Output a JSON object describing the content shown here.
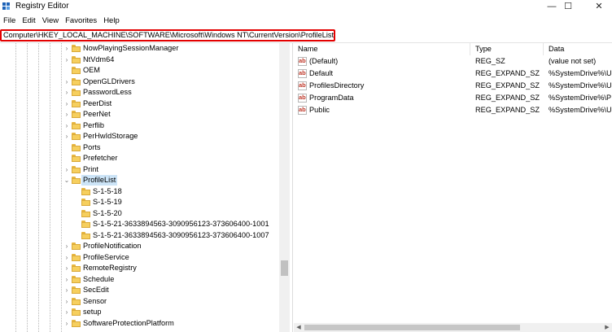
{
  "window": {
    "title": "Registry Editor",
    "minimize_glyph": "—",
    "maximize_glyph": "☐",
    "close_glyph": "✕"
  },
  "menu": [
    "File",
    "Edit",
    "View",
    "Favorites",
    "Help"
  ],
  "address": "Computer\\HKEY_LOCAL_MACHINE\\SOFTWARE\\Microsoft\\Windows NT\\CurrentVersion\\ProfileList",
  "tree": {
    "items": [
      {
        "label": "NowPlayingSessionManager",
        "level": 1,
        "expander": "›"
      },
      {
        "label": "NtVdm64",
        "level": 1,
        "expander": "›"
      },
      {
        "label": "OEM",
        "level": 1,
        "expander": ""
      },
      {
        "label": "OpenGLDrivers",
        "level": 1,
        "expander": "›"
      },
      {
        "label": "PasswordLess",
        "level": 1,
        "expander": "›"
      },
      {
        "label": "PeerDist",
        "level": 1,
        "expander": "›"
      },
      {
        "label": "PeerNet",
        "level": 1,
        "expander": "›"
      },
      {
        "label": "Perflib",
        "level": 1,
        "expander": "›"
      },
      {
        "label": "PerHwIdStorage",
        "level": 1,
        "expander": "›"
      },
      {
        "label": "Ports",
        "level": 1,
        "expander": ""
      },
      {
        "label": "Prefetcher",
        "level": 1,
        "expander": ""
      },
      {
        "label": "Print",
        "level": 1,
        "expander": "›"
      },
      {
        "label": "ProfileList",
        "level": 1,
        "expander": "⌄",
        "selected": true
      },
      {
        "label": "S-1-5-18",
        "level": 2,
        "expander": ""
      },
      {
        "label": "S-1-5-19",
        "level": 2,
        "expander": ""
      },
      {
        "label": "S-1-5-20",
        "level": 2,
        "expander": ""
      },
      {
        "label": "S-1-5-21-3633894563-3090956123-373606400-1001",
        "level": 2,
        "expander": ""
      },
      {
        "label": "S-1-5-21-3633894563-3090956123-373606400-1007",
        "level": 2,
        "expander": ""
      },
      {
        "label": "ProfileNotification",
        "level": 1,
        "expander": "›"
      },
      {
        "label": "ProfileService",
        "level": 1,
        "expander": "›"
      },
      {
        "label": "RemoteRegistry",
        "level": 1,
        "expander": "›"
      },
      {
        "label": "Schedule",
        "level": 1,
        "expander": "›"
      },
      {
        "label": "SecEdit",
        "level": 1,
        "expander": "›"
      },
      {
        "label": "Sensor",
        "level": 1,
        "expander": "›"
      },
      {
        "label": "setup",
        "level": 1,
        "expander": "›"
      },
      {
        "label": "SoftwareProtectionPlatform",
        "level": 1,
        "expander": "›"
      }
    ]
  },
  "values": {
    "columns": [
      "Name",
      "Type",
      "Data"
    ],
    "icon": "ab",
    "rows": [
      {
        "name": "(Default)",
        "type": "REG_SZ",
        "data": "(value not set)"
      },
      {
        "name": "Default",
        "type": "REG_EXPAND_SZ",
        "data": "%SystemDrive%\\U"
      },
      {
        "name": "ProfilesDirectory",
        "type": "REG_EXPAND_SZ",
        "data": "%SystemDrive%\\U"
      },
      {
        "name": "ProgramData",
        "type": "REG_EXPAND_SZ",
        "data": "%SystemDrive%\\P"
      },
      {
        "name": "Public",
        "type": "REG_EXPAND_SZ",
        "data": "%SystemDrive%\\U"
      }
    ]
  },
  "scrollbar": {
    "left_arrow": "◀",
    "right_arrow": "▶"
  },
  "colors": {
    "highlight_border": "#e30000",
    "selection": "#cce4f7",
    "folder": "#f6cf5e"
  }
}
